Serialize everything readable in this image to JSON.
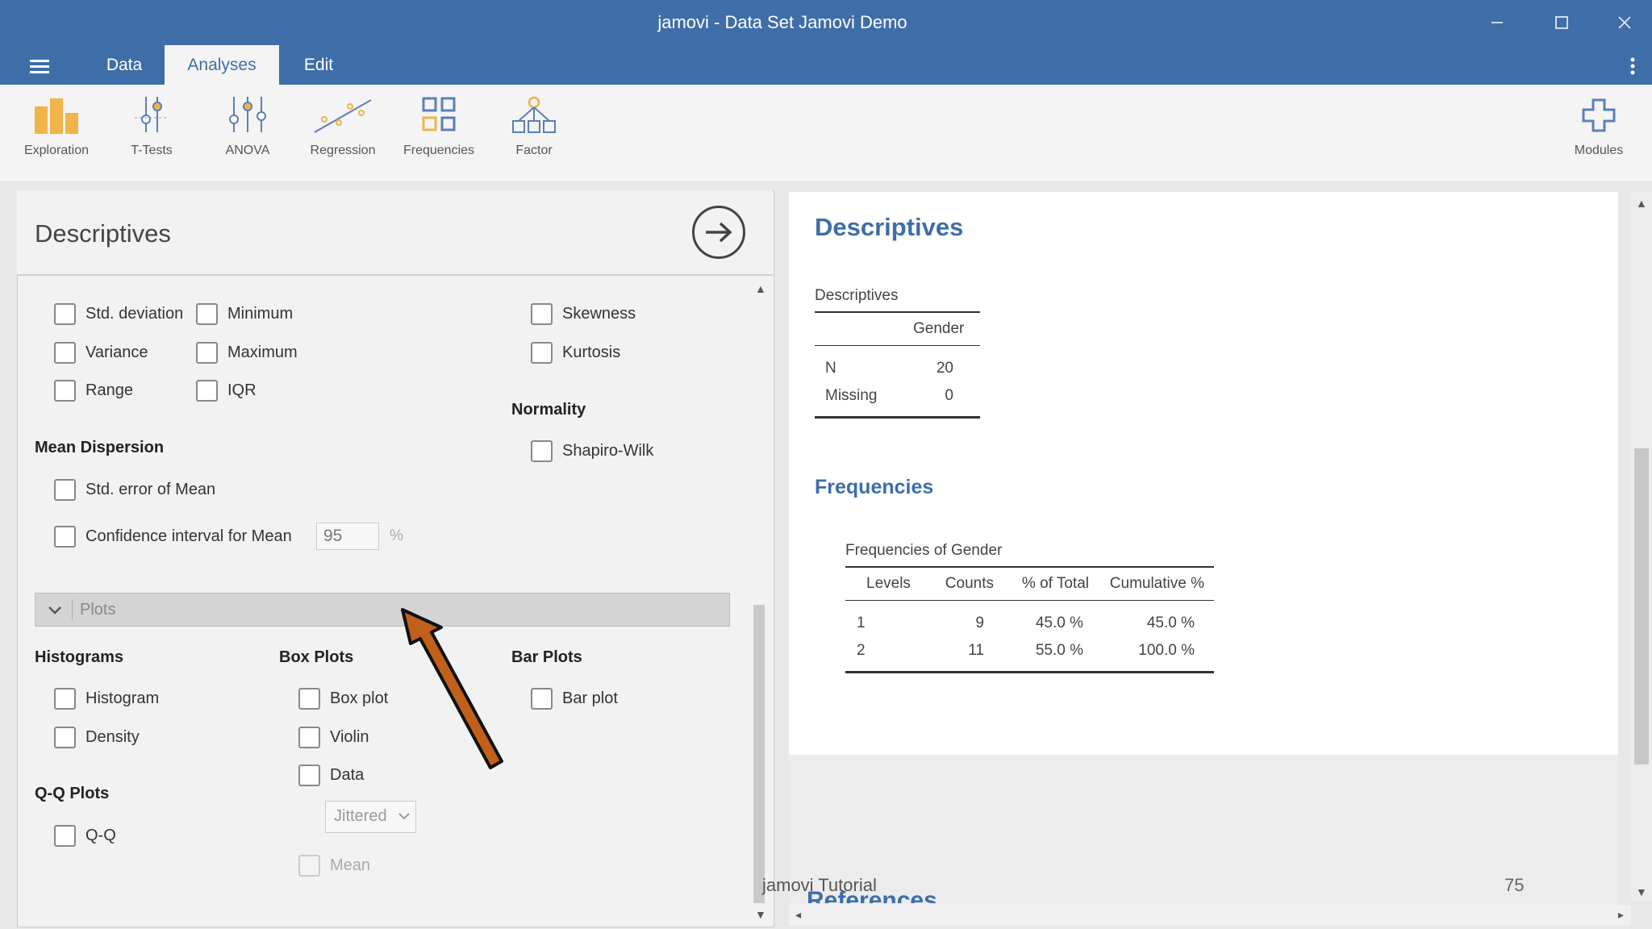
{
  "window": {
    "title": "jamovi - Data Set Jamovi Demo"
  },
  "menu": {
    "tabs": [
      {
        "label": "Data"
      },
      {
        "label": "Analyses"
      },
      {
        "label": "Edit"
      }
    ]
  },
  "ribbon": {
    "tools": [
      {
        "label": "Exploration",
        "icon": "exploration-icon"
      },
      {
        "label": "T-Tests",
        "icon": "ttests-icon"
      },
      {
        "label": "ANOVA",
        "icon": "anova-icon"
      },
      {
        "label": "Regression",
        "icon": "regression-icon"
      },
      {
        "label": "Frequencies",
        "icon": "frequencies-icon"
      },
      {
        "label": "Factor",
        "icon": "factor-icon"
      }
    ],
    "modules_label": "Modules"
  },
  "options": {
    "title": "Descriptives",
    "dispersion": {
      "std_dev": "Std. deviation",
      "variance": "Variance",
      "range": "Range",
      "minimum": "Minimum",
      "maximum": "Maximum",
      "iqr": "IQR"
    },
    "distribution": {
      "skewness": "Skewness",
      "kurtosis": "Kurtosis"
    },
    "normality": {
      "heading": "Normality",
      "shapiro": "Shapiro-Wilk"
    },
    "mean_dispersion": {
      "heading": "Mean Dispersion",
      "se_mean": "Std. error of Mean",
      "ci_mean": "Confidence interval for Mean",
      "ci_value": "95",
      "ci_unit": "%"
    },
    "plots": {
      "label": "Plots",
      "histograms": {
        "heading": "Histograms",
        "histogram": "Histogram",
        "density": "Density"
      },
      "boxplots": {
        "heading": "Box Plots",
        "box": "Box plot",
        "violin": "Violin",
        "data": "Data",
        "jitter_value": "Jittered",
        "mean": "Mean"
      },
      "barplots": {
        "heading": "Bar Plots",
        "bar": "Bar plot"
      },
      "qq": {
        "heading": "Q-Q Plots",
        "qq": "Q-Q"
      }
    }
  },
  "results": {
    "descriptives": {
      "title": "Descriptives",
      "table_caption": "Descriptives",
      "column": "Gender",
      "rows": [
        {
          "label": "N",
          "value": "20"
        },
        {
          "label": "Missing",
          "value": "0"
        }
      ]
    },
    "frequencies": {
      "title": "Frequencies",
      "table_caption": "Frequencies of Gender",
      "headers": [
        "Levels",
        "Counts",
        "% of Total",
        "Cumulative %"
      ],
      "rows": [
        [
          "1",
          "9",
          "45.0 %",
          "45.0 %"
        ],
        [
          "2",
          "11",
          "55.0 %",
          "100.0 %"
        ]
      ]
    },
    "references_title": "References"
  },
  "footer": {
    "left": "jamovi Tutorial",
    "right": "75"
  },
  "colors": {
    "brand": "#3e6ea8",
    "annotation_arrow": "#c0601a"
  }
}
